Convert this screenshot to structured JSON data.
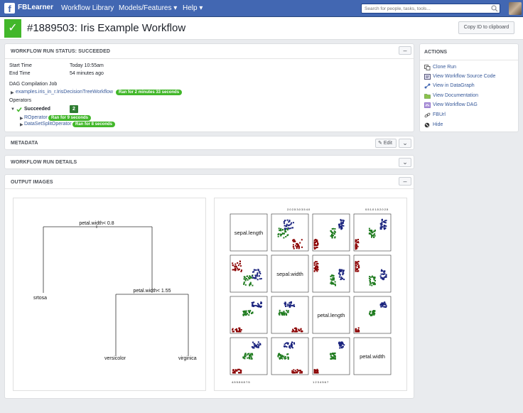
{
  "topbar": {
    "brand": "FBLearner",
    "nav": [
      "Workflow Library",
      "Models/Features ▾",
      "Help ▾"
    ],
    "search_placeholder": "Search for people, tasks, tools..."
  },
  "header": {
    "title": "#1889503: Iris Example Workflow",
    "copy_button": "Copy ID to clipboard"
  },
  "status_panel": {
    "title": "WORKFLOW RUN STATUS: SUCCEEDED",
    "collapse_label": "–",
    "start_label": "Start Time",
    "start_value": "Today 10:55am",
    "end_label": "End Time",
    "end_value": "54 minutes ago",
    "dag_label": "DAG Compilation Job",
    "dag_link": "examples.iris_in_r.IrisDecisionTreeWorkflow",
    "dag_badge": "Ran for 2 minutes 33 seconds",
    "operators_label": "Operators",
    "succeeded_label": "Succeeded",
    "succeeded_count": "2",
    "operators": [
      {
        "name": "ROperator",
        "badge": "Ran for 9 seconds"
      },
      {
        "name": "DataSetSplitOperator",
        "badge": "Ran for 8 seconds"
      }
    ]
  },
  "actions": {
    "title": "ACTIONS",
    "items": [
      "Clone Run",
      "View Workflow Source Code",
      "View in DataGraph",
      "View Documentation",
      "View Workflow DAG",
      "FBUrl",
      "Hide"
    ]
  },
  "metadata_panel": {
    "title": "METADATA",
    "edit_label": "Edit",
    "chevron": "⌄"
  },
  "details_panel": {
    "title": "WORKFLOW RUN DETAILS",
    "chevron": "⌄"
  },
  "output_panel": {
    "title": "OUTPUT IMAGES",
    "collapse_label": "–"
  },
  "tree": {
    "split1": "petal.width< 0.8",
    "split2": "petal.width< 1.55",
    "leaves": [
      "srtosa",
      "versicolor",
      "virginica"
    ]
  },
  "pairs": {
    "labels": [
      "sepal.length",
      "sepal.width",
      "petal.length",
      "petal.width"
    ],
    "top_ticks_col2": "2.0 2.5 3.0 3.5 4.0",
    "top_ticks_col4": "0.5 1.0 1.5 2.0 2.5",
    "bottom_ticks_col1": "4.5 5.5 6.5 7.5",
    "bottom_ticks_col3": "1 2 3 4 5 6 7",
    "colors": {
      "setosa": "#8b0000",
      "versicolor": "#1e7b1e",
      "virginica": "#1a237e"
    }
  }
}
